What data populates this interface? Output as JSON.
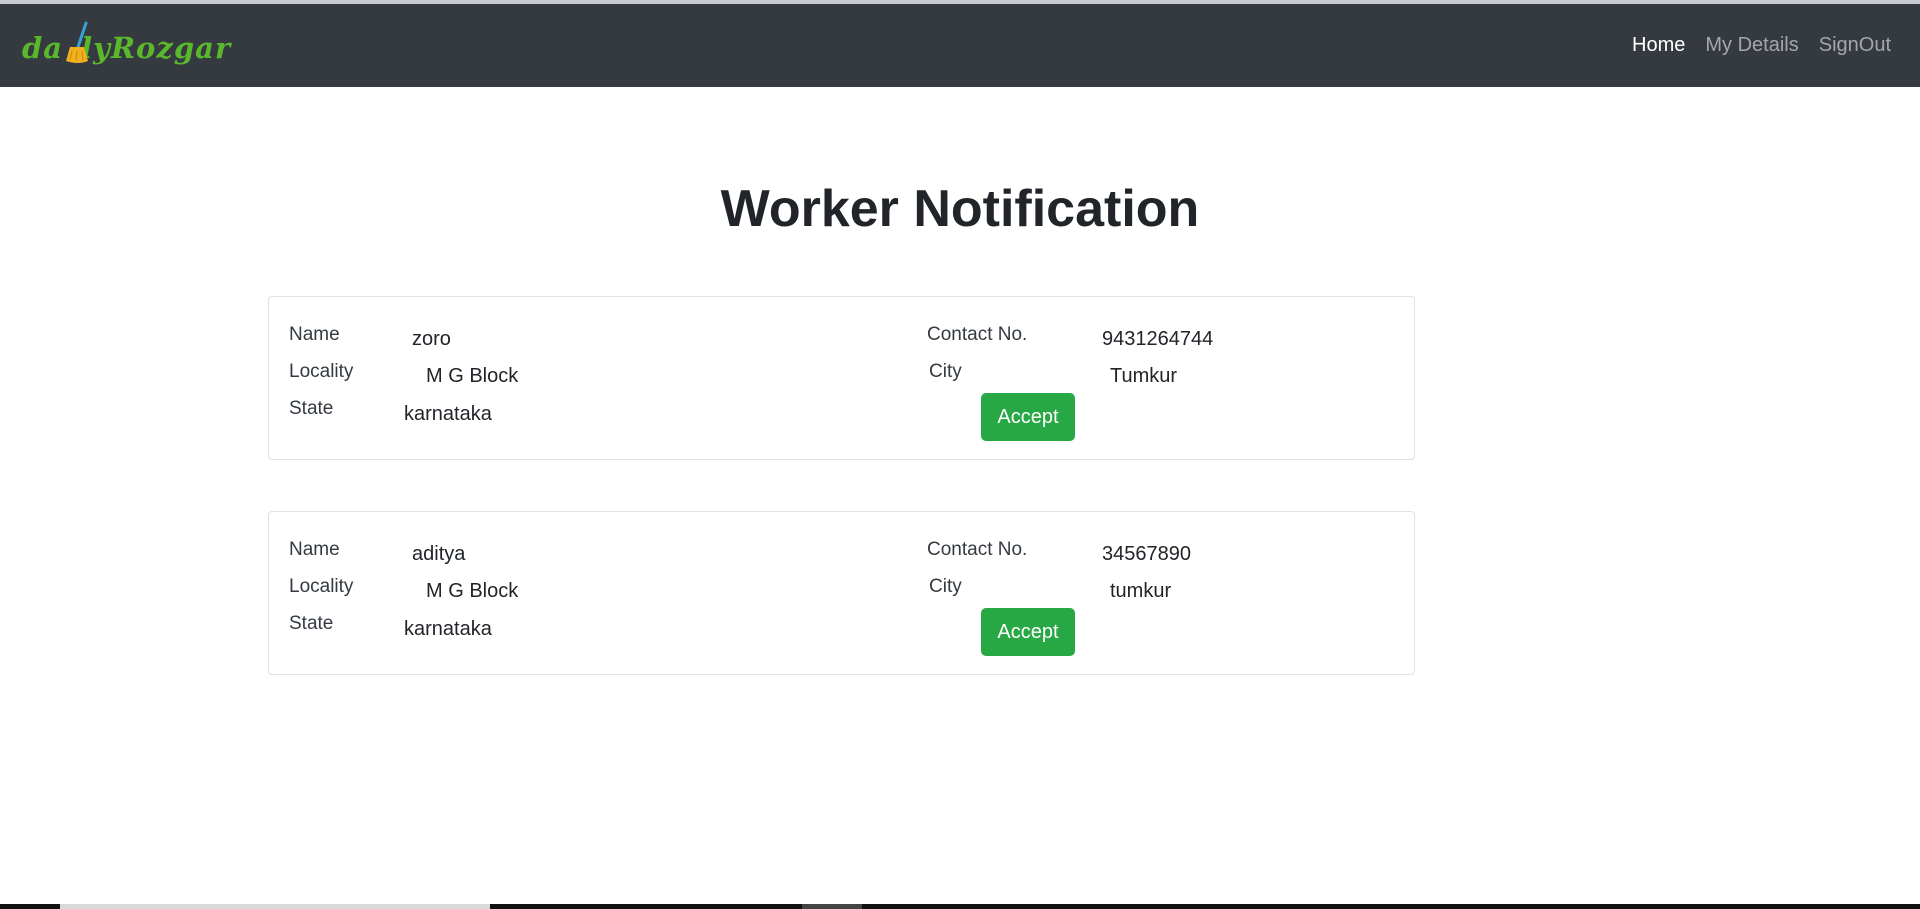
{
  "brand": {
    "logo_text": "dailyRozgar",
    "colors": {
      "green": "#5ab82a",
      "broom_handle": "#3aa0d8",
      "broom_head": "#f0b020"
    }
  },
  "nav": {
    "items": [
      {
        "label": "Home",
        "active": true
      },
      {
        "label": "My Details",
        "active": false
      },
      {
        "label": "SignOut",
        "active": false
      }
    ]
  },
  "page": {
    "title": "Worker Notification"
  },
  "labels": {
    "name": "Name",
    "locality": "Locality",
    "state": "State",
    "contact": "Contact No.",
    "city": "City",
    "accept": "Accept"
  },
  "notifications": [
    {
      "name": "zoro",
      "locality": "M G Block",
      "state": "karnataka",
      "contact": "9431264744",
      "city": "Tumkur"
    },
    {
      "name": "aditya",
      "locality": "M G Block",
      "state": "karnataka",
      "contact": "34567890",
      "city": "tumkur"
    }
  ],
  "colors": {
    "navbar": "#343a40",
    "accept_button": "#28a745"
  }
}
